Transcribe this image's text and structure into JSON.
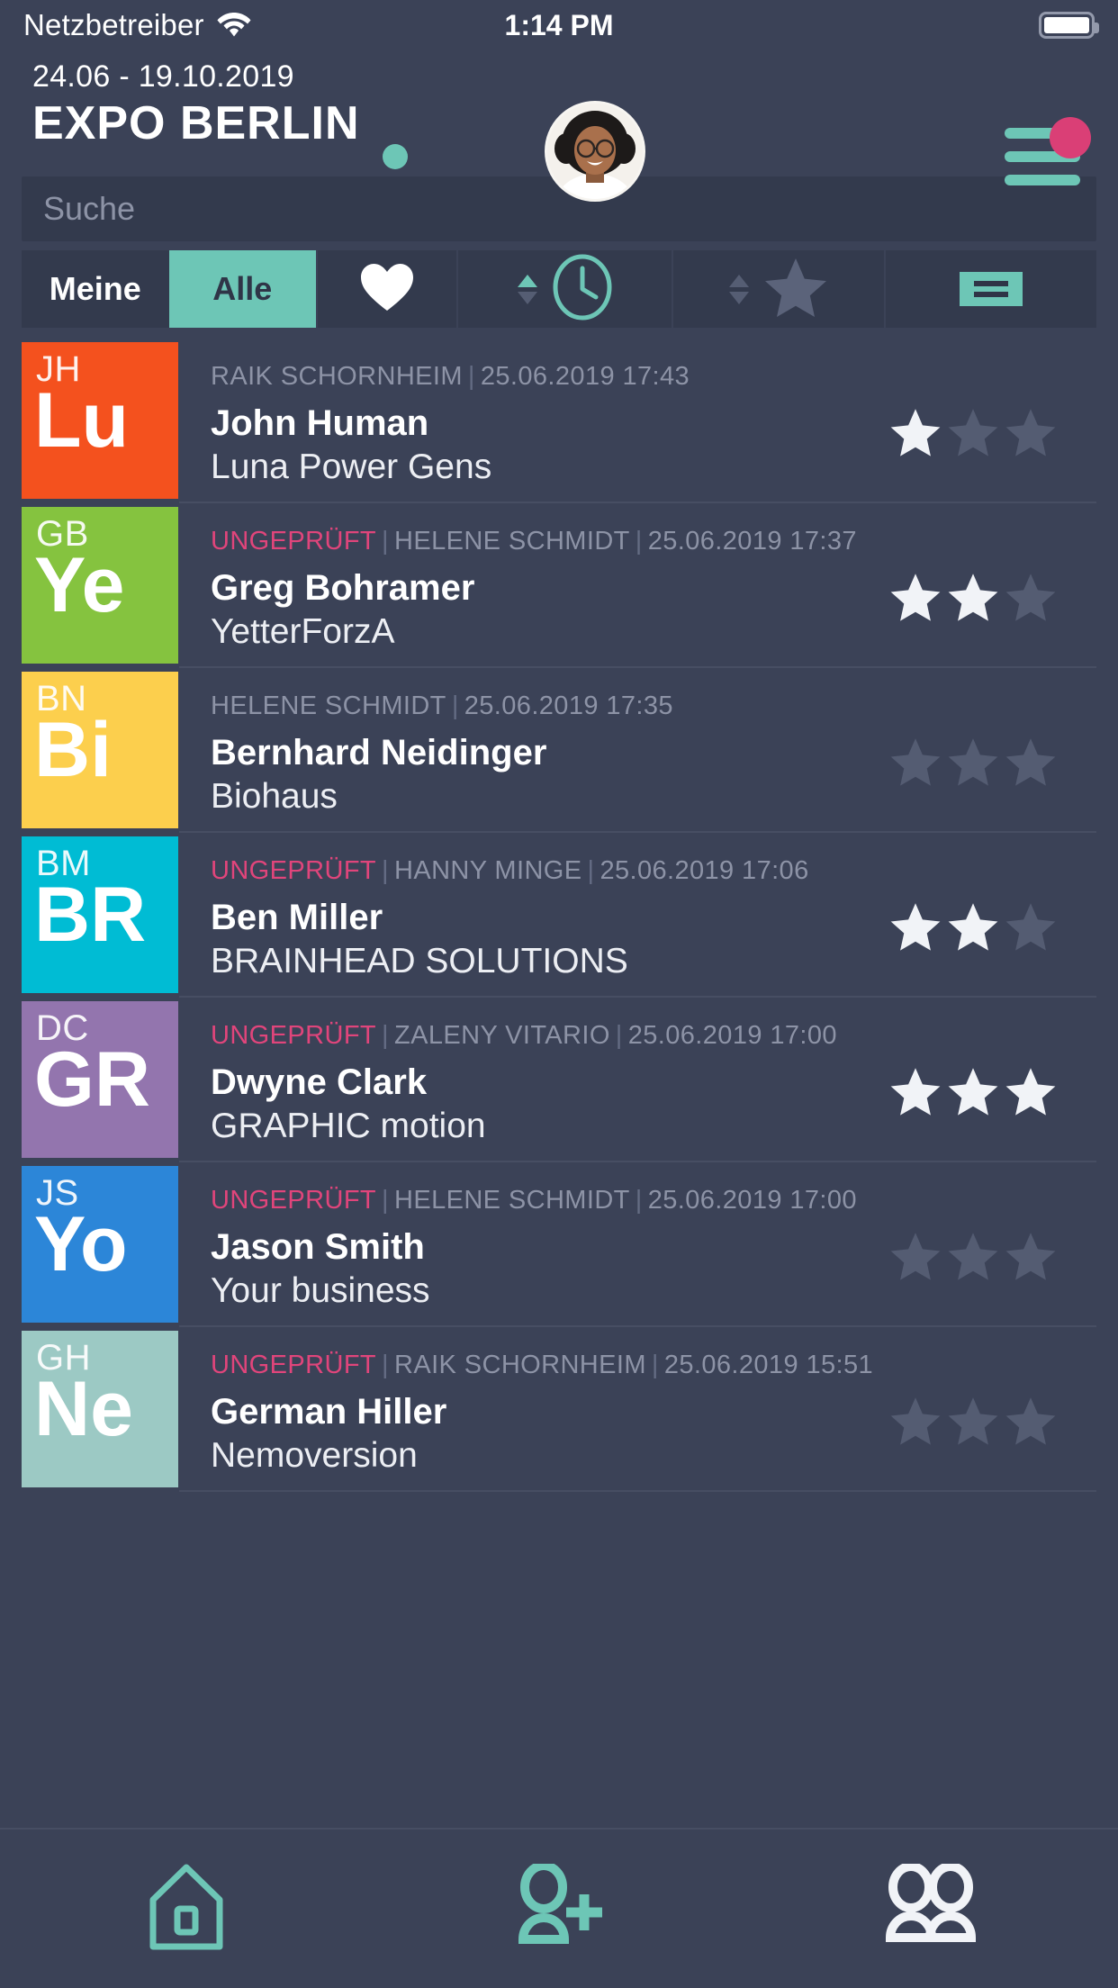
{
  "statusbar": {
    "carrier": "Netzbetreiber",
    "wifi_icon": "wifi-icon",
    "time": "1:14 PM",
    "battery_icon": "battery-full-icon"
  },
  "header": {
    "date_range": "24.06 - 19.10.2019",
    "title": "EXPO BERLIN",
    "status_dot_color": "#6dc6b6",
    "avatar_name": "avatar",
    "menu_icon": "hamburger-menu-icon",
    "menu_badge_color": "#da3f76"
  },
  "search": {
    "placeholder": "Suche",
    "value": ""
  },
  "filters": {
    "segments": [
      {
        "label": "Meine",
        "active": false
      },
      {
        "label": "Alle",
        "active": true
      }
    ],
    "favorite_icon": "heart-icon",
    "sort_time_icon": "clock-icon",
    "sort_rating_icon": "star-icon",
    "density_icon": "list-density-icon",
    "accent_color": "#6dc6b6"
  },
  "list": {
    "rows": [
      {
        "tile_initials": "JH",
        "tile_label": "Lu",
        "tile_color": "#f4511e",
        "unchecked": "",
        "person": "RAIK SCHORNHEIM",
        "timestamp": "25.06.2019 17:43",
        "name": "John Human",
        "company": "Luna Power Gens",
        "rating": 1,
        "rating_max": 3
      },
      {
        "tile_initials": "GB",
        "tile_label": "Ye",
        "tile_color": "#85c33f",
        "unchecked": "UNGEPRÜFT",
        "person": "HELENE SCHMIDT",
        "timestamp": "25.06.2019 17:37",
        "name": "Greg Bohramer",
        "company": "YetterForzA",
        "rating": 2,
        "rating_max": 3
      },
      {
        "tile_initials": "BN",
        "tile_label": "Bi",
        "tile_color": "#fccf4d",
        "unchecked": "",
        "person": "HELENE SCHMIDT",
        "timestamp": "25.06.2019 17:35",
        "name": "Bernhard Neidinger",
        "company": "Biohaus",
        "rating": 0,
        "rating_max": 3
      },
      {
        "tile_initials": "BM",
        "tile_label": "BR",
        "tile_color": "#00bcd4",
        "unchecked": "UNGEPRÜFT",
        "person": "HANNY MINGE",
        "timestamp": "25.06.2019 17:06",
        "name": "Ben Miller",
        "company": "BRAINHEAD SOLUTIONS",
        "rating": 2,
        "rating_max": 3
      },
      {
        "tile_initials": "DC",
        "tile_label": "GR",
        "tile_color": "#9375ae",
        "unchecked": "UNGEPRÜFT",
        "person": "ZALENY VITARIO",
        "timestamp": "25.06.2019 17:00",
        "name": "Dwyne Clark",
        "company": "GRAPHIC motion",
        "rating": 3,
        "rating_max": 3
      },
      {
        "tile_initials": "JS",
        "tile_label": "Yo",
        "tile_color": "#2c86d8",
        "unchecked": "UNGEPRÜFT",
        "person": "HELENE SCHMIDT",
        "timestamp": "25.06.2019 17:00",
        "name": "Jason Smith",
        "company": "Your business",
        "rating": 0,
        "rating_max": 3
      },
      {
        "tile_initials": "GH",
        "tile_label": "Ne",
        "tile_color": "#9cc9c4",
        "unchecked": "UNGEPRÜFT",
        "person": "RAIK SCHORNHEIM",
        "timestamp": "25.06.2019 15:51",
        "name": "German Hiller",
        "company": "Nemoversion",
        "rating": 0,
        "rating_max": 3
      }
    ]
  },
  "bottomnav": {
    "items": [
      {
        "icon": "home-icon",
        "active": false
      },
      {
        "icon": "add-person-icon",
        "active": false
      },
      {
        "icon": "people-group-icon",
        "active": true
      }
    ]
  }
}
